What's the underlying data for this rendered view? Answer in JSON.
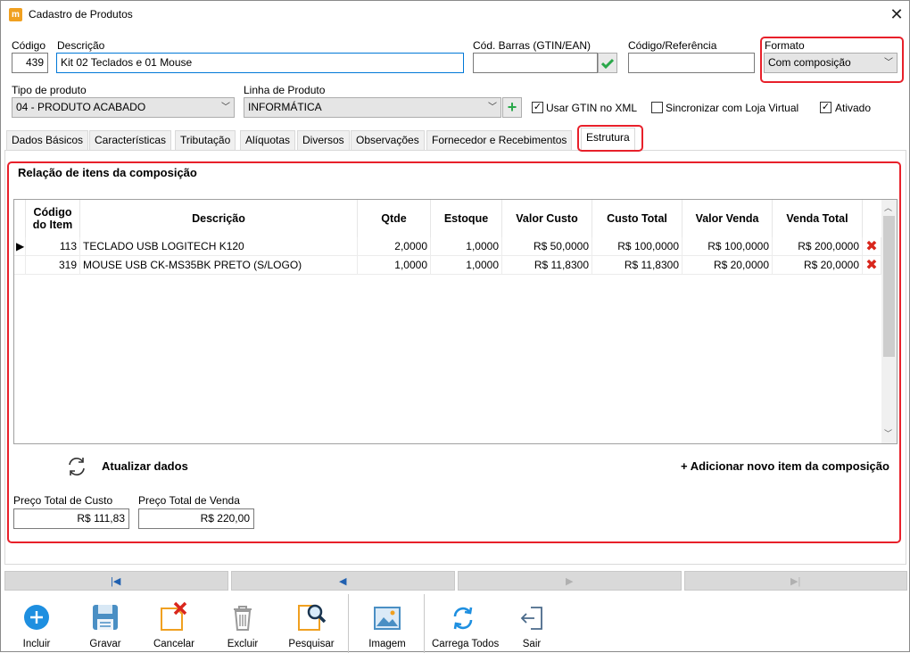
{
  "window": {
    "title": "Cadastro de Produtos",
    "app_icon_letter": "m"
  },
  "fields": {
    "codigo_label": "Código",
    "codigo_value": "439",
    "descricao_label": "Descrição",
    "descricao_value": "Kit 02 Teclados e 01 Mouse",
    "barras_label": "Cód. Barras (GTIN/EAN)",
    "barras_value": "",
    "referencia_label": "Código/Referência",
    "referencia_value": "",
    "formato_label": "Formato",
    "formato_value": "Com composição",
    "tipo_label": "Tipo de produto",
    "tipo_value": "04 - PRODUTO ACABADO",
    "linha_label": "Linha de Produto",
    "linha_value": "INFORMÁTICA"
  },
  "checkboxes": [
    {
      "label": "Usar GTIN no XML",
      "checked": true
    },
    {
      "label": "Sincronizar com Loja Virtual",
      "checked": false
    },
    {
      "label": "Ativado",
      "checked": true
    }
  ],
  "tabs": [
    "Dados Básicos",
    "Características",
    "Tributação",
    "Alíquotas",
    "Diversos",
    "Observações",
    "Fornecedor e Recebimentos",
    "Estrutura"
  ],
  "active_tab": "Estrutura",
  "composition": {
    "section_title": "Relação de itens da composição",
    "columns": [
      "Código do Item",
      "Descrição",
      "Qtde",
      "Estoque",
      "Valor Custo",
      "Custo Total",
      "Valor Venda",
      "Venda Total"
    ],
    "rows": [
      [
        "113",
        "TECLADO USB LOGITECH K120",
        "2,0000",
        "1,0000",
        "R$ 50,0000",
        "R$ 100,0000",
        "R$ 100,0000",
        "R$ 200,0000"
      ],
      [
        "319",
        "MOUSE USB CK-MS35BK PRETO (S/LOGO)",
        "1,0000",
        "1,0000",
        "R$ 11,8300",
        "R$ 11,8300",
        "R$ 20,0000",
        "R$ 20,0000"
      ]
    ],
    "refresh_label": "Atualizar dados",
    "add_label": "+ Adicionar novo item da composição",
    "total_custo_label": "Preço Total de Custo",
    "total_custo_value": "R$ 111,83",
    "total_venda_label": "Preço Total de Venda",
    "total_venda_value": "R$ 220,00"
  },
  "toolbar": [
    {
      "label": "Incluir",
      "icon": "plus-circle-icon"
    },
    {
      "label": "Gravar",
      "icon": "floppy-disk-icon"
    },
    {
      "label": "Cancelar",
      "icon": "cancel-document-icon"
    },
    {
      "label": "Excluir",
      "icon": "trash-icon"
    },
    {
      "label": "Pesquisar",
      "icon": "search-document-icon"
    },
    {
      "label": "Imagem",
      "icon": "image-icon"
    },
    {
      "label": "Carrega Todos",
      "icon": "refresh-icon"
    },
    {
      "label": "Sair",
      "icon": "exit-icon"
    }
  ],
  "colors": {
    "highlight_red": "#e8202a",
    "accent_blue": "#1e8fe0",
    "check_green": "#2aa84a"
  }
}
